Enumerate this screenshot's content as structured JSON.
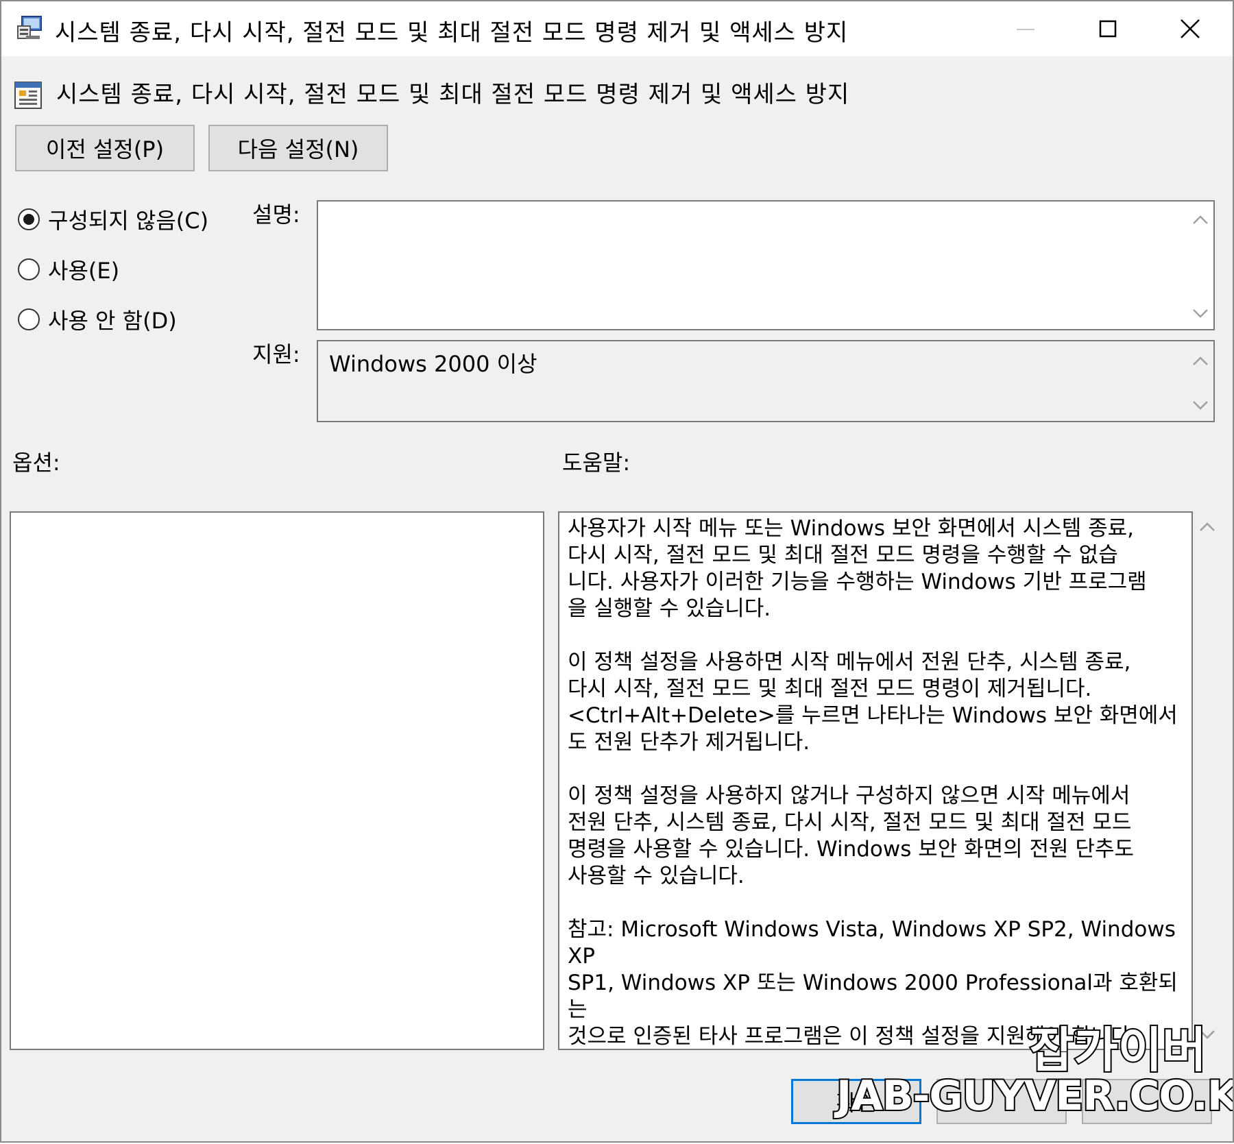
{
  "window": {
    "title": "시스템 종료, 다시 시작, 절전 모드 및 최대 절전 모드 명령 제거 및 액세스 방지",
    "controls": [
      "minimize-icon",
      "maximize-icon",
      "close-icon"
    ]
  },
  "policy": {
    "title": "시스템 종료, 다시 시작, 절전 모드 및 최대 절전 모드 명령 제거 및 액세스 방지"
  },
  "nav": {
    "prev_label": "이전 설정(P)",
    "next_label": "다음 설정(N)"
  },
  "state": {
    "options": [
      {
        "label": "구성되지 않음(C)",
        "selected": true
      },
      {
        "label": "사용(E)",
        "selected": false
      },
      {
        "label": "사용 안 함(D)",
        "selected": false
      }
    ]
  },
  "comment": {
    "label": "설명:",
    "value": ""
  },
  "supported": {
    "label": "지원:",
    "value": "Windows 2000 이상"
  },
  "options_pane": {
    "label": "옵션:"
  },
  "help": {
    "label": "도움말:",
    "paragraphs": [
      "사용자가 시작 메뉴 또는 Windows 보안 화면에서 시스템 종료,\n다시 시작, 절전 모드 및 최대 절전 모드 명령을 수행할 수 없습\n니다. 사용자가 이러한 기능을 수행하는 Windows 기반 프로그램\n을 실행할 수 있습니다.",
      "이 정책 설정을 사용하면 시작 메뉴에서 전원 단추, 시스템 종료,\n다시 시작, 절전 모드 및 최대 절전 모드 명령이 제거됩니다.\n<Ctrl+Alt+Delete>를 누르면 나타나는 Windows 보안 화면에서\n도 전원 단추가 제거됩니다.",
      "이 정책 설정을 사용하지 않거나 구성하지 않으면 시작 메뉴에서\n전원 단추, 시스템 종료, 다시 시작, 절전 모드 및 최대 절전 모드\n명령을 사용할 수 있습니다. Windows 보안 화면의 전원 단추도\n사용할 수 있습니다.",
      "참고: Microsoft Windows Vista, Windows XP SP2, Windows XP\nSP1, Windows XP 또는 Windows 2000 Professional과 호환되는\n것으로 인증된 타사 프로그램은 이 정책 설정을 지원해야 합니다\n."
    ]
  },
  "footer": {
    "ok_label": "확인",
    "cancel_label": "",
    "apply_label": ""
  },
  "watermark": {
    "korean": "잡가이버",
    "url": "JAB-GUYVER.CO.KR"
  },
  "colors": {
    "window_bg": "#f0f0f0",
    "titlebar_bg": "#ffffff",
    "focus_border": "#0078d7"
  }
}
